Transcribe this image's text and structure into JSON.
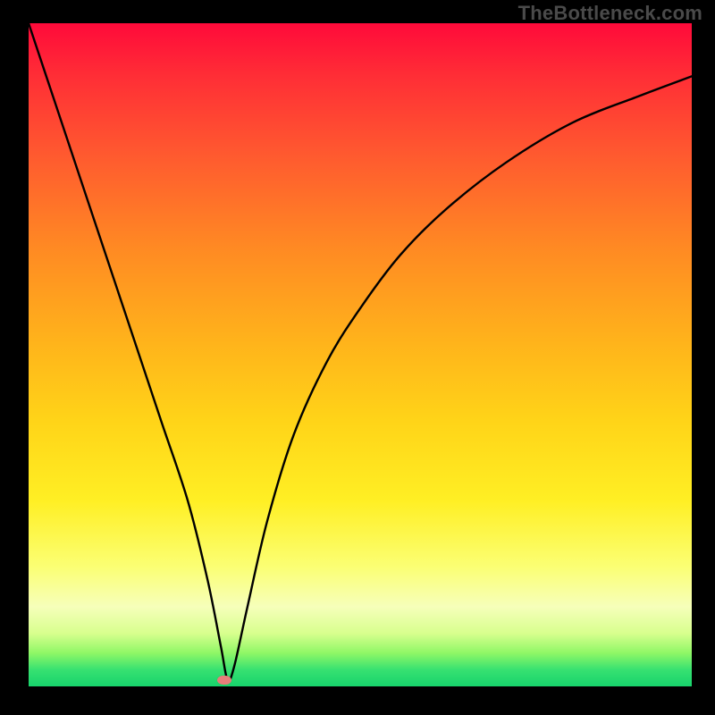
{
  "watermark": "TheBottleneck.com",
  "colors": {
    "background": "#000000",
    "curve": "#000000",
    "marker": "#e77e7a",
    "gradient_stops": [
      "#ff0a3a",
      "#ff2e36",
      "#ff5a2f",
      "#ff8a23",
      "#ffb31b",
      "#ffd418",
      "#ffef24",
      "#fbff74",
      "#f6ffba",
      "#d8ff8e",
      "#8ef766",
      "#37e171",
      "#17d36c"
    ]
  },
  "chart_data": {
    "type": "line",
    "title": "",
    "xlabel": "",
    "ylabel": "",
    "xlim": [
      0,
      100
    ],
    "ylim": [
      0,
      100
    ],
    "grid": false,
    "legend": false,
    "series": [
      {
        "name": "curve",
        "x": [
          0,
          4,
          8,
          12,
          16,
          20,
          24,
          27,
          29,
          30,
          31,
          33,
          36,
          40,
          45,
          50,
          56,
          63,
          72,
          82,
          92,
          100
        ],
        "y": [
          100,
          88,
          76,
          64,
          52,
          40,
          28,
          16,
          6,
          1,
          3,
          12,
          25,
          38,
          49,
          57,
          65,
          72,
          79,
          85,
          89,
          92
        ]
      }
    ],
    "marker": {
      "x": 29.5,
      "y": 1.0
    }
  }
}
